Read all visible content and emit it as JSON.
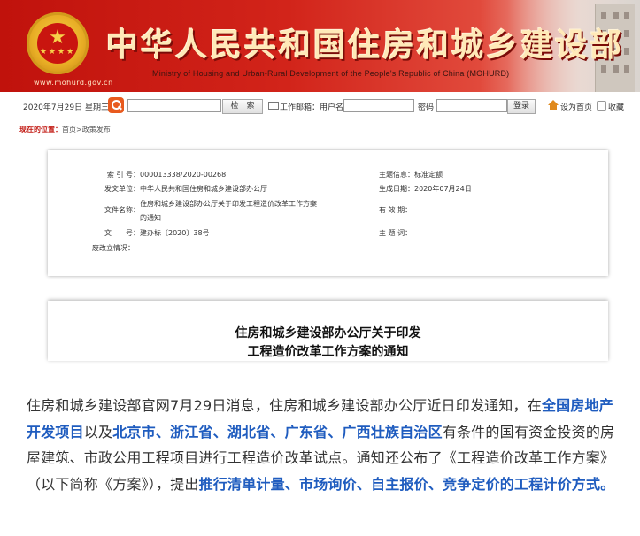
{
  "header": {
    "title_cn": "中华人民共和国住房和城乡建设部",
    "title_en": "Ministry of Housing and Urban-Rural Development of the People's Republic of China (MOHURD)",
    "site_url": "www.mohurd.gov.cn"
  },
  "toolbar": {
    "date": "2020年7月29日 星期三",
    "search_button": "检　索",
    "mail_label": "工作邮箱：用户名",
    "password_label": "密码",
    "login_button": "登录",
    "homepage_link": "设为首页",
    "favorite_link": "收藏"
  },
  "breadcrumb": {
    "here_label": "现在的位置：",
    "path": "首页>政策发布"
  },
  "info": {
    "index_label": "索 引 号：",
    "index_value": "000013338/2020-00268",
    "topic_label": "主题信息：",
    "topic_value": "标准定额",
    "issuer_label": "发文单位：",
    "issuer_value": "中华人民共和国住房和城乡建设部办公厅",
    "date_label": "生成日期：",
    "date_value": "2020年07月24日",
    "filename_label": "文件名称：",
    "filename_line1": "住房和城乡建设部办公厅关于印发工程造价改革工作方案",
    "filename_line2": "的通知",
    "validity_label": "有 效 期：",
    "docno_label": "文　　号：",
    "docno_value": "建办标〔2020〕38号",
    "keywords_label": "主 题 词：",
    "status_label": "废改立情况："
  },
  "doc_title": {
    "line1": "住房和城乡建设部办公厅关于印发",
    "line2": "工程造价改革工作方案的通知"
  },
  "article": {
    "p1": "住房和城乡建设部官网7月29日消息，住房和城乡建设部办公厅近日印发通知，在",
    "h1": "全国房地产开发项目",
    "p2": "以及",
    "h2": "北京市、浙江省、湖北省、广东省、广西壮族自治区",
    "p3": "有条件的国有资金投资的房屋建筑、市政公用工程项目进行工程造价改革试点。通知还公布了《工程造价改革工作方案》（以下简称《方案》），提出",
    "h3": "推行清单计量、市场询价、自主报价、竞争定价的工程计价方式。"
  },
  "colors": {
    "banner_red": "#c0120c",
    "highlight_blue": "#1f5cbf",
    "crumb_red": "#c1160f"
  }
}
